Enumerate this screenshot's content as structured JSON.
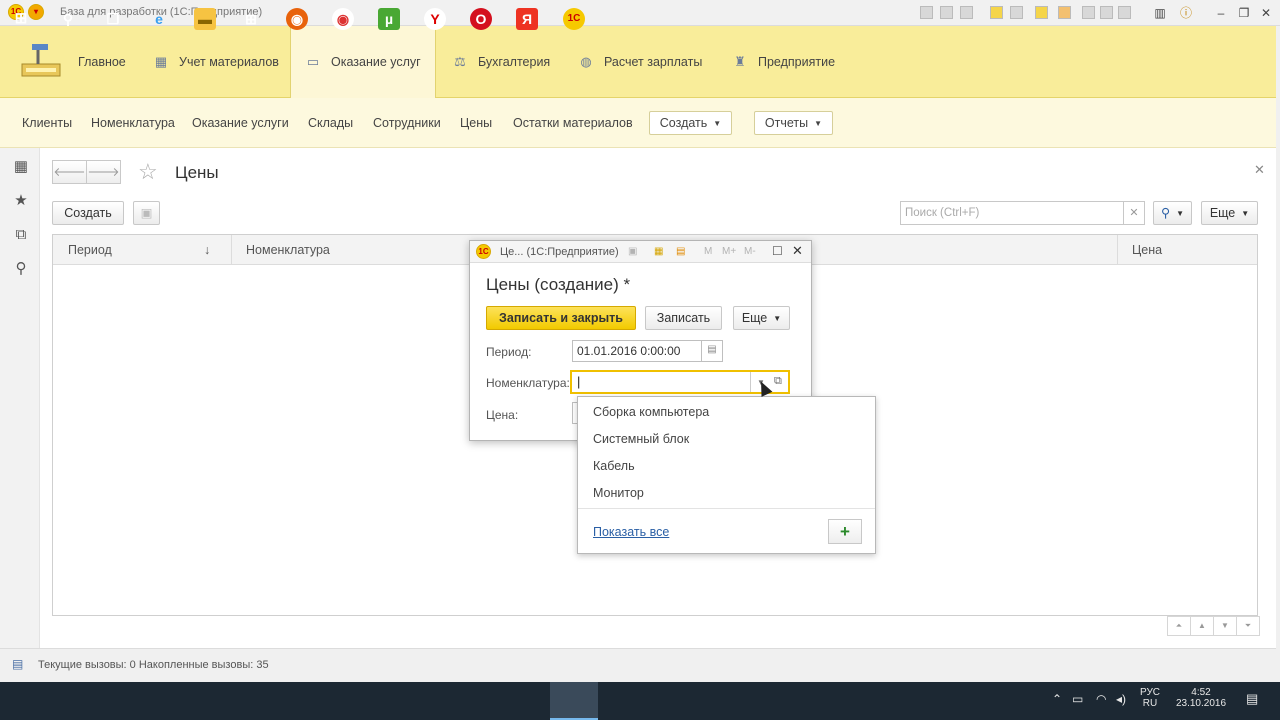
{
  "window": {
    "title": "База для разработки  (1С:Предприятие)"
  },
  "sections": {
    "items": [
      {
        "label": "Главное",
        "icon": "menu-icon"
      },
      {
        "label": "Учет материалов",
        "icon": "table-icon"
      },
      {
        "label": "Оказание услуг",
        "icon": "monitor-icon",
        "active": true
      },
      {
        "label": "Бухгалтерия",
        "icon": "balance-icon"
      },
      {
        "label": "Расчет зарплаты",
        "icon": "coins-icon"
      },
      {
        "label": "Предприятие",
        "icon": "factory-icon"
      }
    ]
  },
  "navbar": {
    "links": [
      "Клиенты",
      "Номенклатура",
      "Оказание услуги",
      "Склады",
      "Сотрудники",
      "Цены",
      "Остатки материалов"
    ],
    "create_label": "Создать",
    "reports_label": "Отчеты"
  },
  "form": {
    "title": "Цены",
    "create_label": "Создать",
    "search_placeholder": "Поиск (Ctrl+F)",
    "more_label": "Еще",
    "columns": {
      "period": "Период",
      "sort_arrow": "↓",
      "nomenclature": "Номенклатура",
      "price": "Цена"
    }
  },
  "dialog": {
    "window_title": "Це...  (1С:Предприятие)",
    "heading": "Цены (создание) *",
    "save_close_label": "Записать и закрыть",
    "save_label": "Записать",
    "more_label": "Еще",
    "period_label": "Период:",
    "period_value": "01.01.2016  0:00:00",
    "nomenclature_label": "Номенклатура:",
    "nomenclature_value": "",
    "price_label": "Цена:"
  },
  "dropdown": {
    "items": [
      "Сборка компьютера",
      "Системный блок",
      "Кабель",
      "Монитор"
    ],
    "show_all_label": "Показать все"
  },
  "status": {
    "text": "Текущие вызовы: 0   Накопленные вызовы: 35"
  },
  "taskbar": {
    "lang1": "РУС",
    "lang2": "RU",
    "time": "4:52",
    "date": "23.10.2016"
  },
  "colors": {
    "accent": "#f2ca00",
    "section_bg": "#f9ed9a",
    "nav_bg": "#fdf9de",
    "link": "#2a5fa5"
  }
}
